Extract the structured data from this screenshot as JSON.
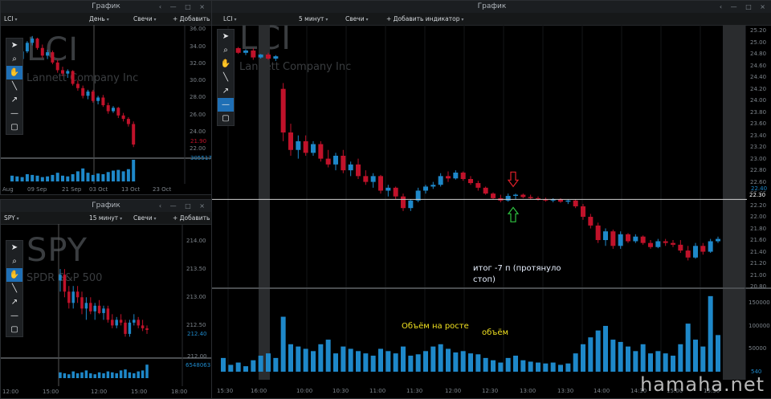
{
  "left_top": {
    "window_title": "График",
    "symbol": "LCI",
    "interval": "День",
    "style": "Свечи",
    "add": "+ Добавить",
    "watermark_symbol": "LCI",
    "watermark_name": "Lannett Company Inc",
    "price_labels": [
      "36.00",
      "34.00",
      "32.00",
      "30.00",
      "28.00",
      "26.00",
      "24.00",
      "22.00"
    ],
    "last_price": "21.90",
    "last_volume": "3055177",
    "x_labels": [
      "Aug",
      "09 Sep",
      "21 Sep",
      "03 Oct",
      "13 Oct",
      "23 Oct"
    ]
  },
  "left_bottom": {
    "window_title": "График",
    "symbol": "SPY",
    "interval": "15 минут",
    "style": "Свечи",
    "add": "+ Добавить",
    "watermark_symbol": "SPY",
    "watermark_name": "SPDR S&P 500",
    "price_labels": [
      "214.00",
      "213.50",
      "213.00",
      "212.50"
    ],
    "last_price": "212.40",
    "aux_label": "212.00",
    "last_volume": "6548063",
    "x_labels": [
      "12:00",
      "15:00",
      "12:00",
      "15:00",
      "18:00"
    ]
  },
  "main": {
    "window_title": "График",
    "symbol": "LCI",
    "interval": "5 минут",
    "style": "Свечи",
    "add_indicator": "+ Добавить индикатор",
    "watermark_symbol": "LCI",
    "watermark_name": "Lannett Company Inc",
    "price_labels": [
      "25.20",
      "25.00",
      "24.80",
      "24.60",
      "24.40",
      "24.20",
      "24.00",
      "23.80",
      "23.60",
      "23.40",
      "23.20",
      "23.00",
      "22.80",
      "22.60",
      "22.40",
      "22.20",
      "22.00",
      "21.80",
      "21.60",
      "21.40",
      "21.20",
      "21.00",
      "20.80"
    ],
    "hline_price": "22.30",
    "pre_price": "22.40",
    "volume_labels": [
      "150000",
      "100000",
      "50000"
    ],
    "last_volume": "540",
    "x_labels": [
      "15:30",
      "16:00",
      "10:00",
      "10:30",
      "11:00",
      "11:30",
      "12:00",
      "12:30",
      "13:00",
      "13:30",
      "14:00",
      "14:30",
      "15:00",
      "15:30"
    ],
    "annotation_result": "итог -7 п (протянуло\nстоп)",
    "annotation_volume_rise": "Объём на росте",
    "annotation_volume": "объём"
  },
  "tools": [
    "cursor-arrow",
    "zoom",
    "hand",
    "line",
    "arrow",
    "horizontal-line",
    "rectangle"
  ],
  "site_watermark": "hamaha.net",
  "colors": {
    "up": "#1e88c9",
    "down": "#c0122a",
    "volume": "#1e88c9",
    "hline": "#d0d0d0"
  },
  "chart_data": [
    {
      "type": "candlestick",
      "symbol": "LCI",
      "interval": "5 минут",
      "x": [
        "15:30",
        "16:00",
        "10:00",
        "10:30",
        "11:00",
        "11:30",
        "12:00",
        "12:30",
        "13:00",
        "13:30",
        "14:00",
        "14:30",
        "15:00",
        "15:30"
      ],
      "ylim": [
        20.8,
        25.3
      ],
      "candles_ohlc": [
        [
          24.88,
          24.95,
          24.78,
          24.85
        ],
        [
          24.85,
          24.92,
          24.8,
          24.9
        ],
        [
          24.9,
          24.92,
          24.8,
          24.82
        ],
        [
          24.82,
          24.88,
          24.78,
          24.86
        ],
        [
          24.86,
          24.9,
          24.7,
          24.74
        ],
        [
          24.74,
          24.8,
          24.72,
          24.79
        ],
        [
          24.79,
          24.82,
          24.7,
          24.72
        ],
        [
          24.72,
          24.78,
          24.68,
          24.76
        ],
        [
          24.2,
          24.3,
          23.3,
          23.45
        ],
        [
          23.45,
          23.6,
          23.05,
          23.15
        ],
        [
          23.15,
          23.4,
          23.0,
          23.3
        ],
        [
          23.3,
          23.4,
          23.05,
          23.1
        ],
        [
          23.1,
          23.3,
          23.05,
          23.25
        ],
        [
          23.25,
          23.3,
          22.95,
          23.0
        ],
        [
          23.0,
          23.15,
          22.85,
          22.9
        ],
        [
          22.9,
          23.1,
          22.8,
          23.05
        ],
        [
          23.05,
          23.15,
          22.75,
          22.8
        ],
        [
          22.8,
          22.95,
          22.7,
          22.9
        ],
        [
          22.9,
          23.0,
          22.65,
          22.7
        ],
        [
          22.7,
          22.8,
          22.55,
          22.6
        ],
        [
          22.6,
          22.75,
          22.5,
          22.7
        ],
        [
          22.7,
          22.72,
          22.4,
          22.45
        ],
        [
          22.45,
          22.55,
          22.35,
          22.5
        ],
        [
          22.5,
          22.52,
          22.3,
          22.35
        ],
        [
          22.35,
          22.4,
          22.1,
          22.15
        ],
        [
          22.15,
          22.3,
          22.1,
          22.28
        ],
        [
          22.28,
          22.5,
          22.25,
          22.45
        ],
        [
          22.45,
          22.55,
          22.4,
          22.52
        ],
        [
          22.52,
          22.6,
          22.48,
          22.55
        ],
        [
          22.55,
          22.75,
          22.52,
          22.7
        ],
        [
          22.7,
          22.78,
          22.6,
          22.66
        ],
        [
          22.66,
          22.8,
          22.64,
          22.76
        ],
        [
          22.76,
          22.78,
          22.62,
          22.65
        ],
        [
          22.65,
          22.7,
          22.55,
          22.58
        ],
        [
          22.58,
          22.62,
          22.45,
          22.5
        ],
        [
          22.5,
          22.52,
          22.38,
          22.4
        ],
        [
          22.4,
          22.42,
          22.3,
          22.32
        ],
        [
          22.32,
          22.38,
          22.25,
          22.28
        ],
        [
          22.28,
          22.4,
          22.26,
          22.36
        ],
        [
          22.36,
          22.4,
          22.3,
          22.38
        ],
        [
          22.38,
          22.4,
          22.32,
          22.34
        ],
        [
          22.34,
          22.38,
          22.3,
          22.32
        ],
        [
          22.32,
          22.35,
          22.28,
          22.3
        ],
        [
          22.3,
          22.33,
          22.26,
          22.28
        ],
        [
          22.28,
          22.32,
          22.25,
          22.3
        ],
        [
          22.3,
          22.32,
          22.24,
          22.26
        ],
        [
          22.26,
          22.3,
          22.22,
          22.28
        ],
        [
          22.28,
          22.3,
          22.15,
          22.18
        ],
        [
          22.18,
          22.22,
          21.95,
          22.0
        ],
        [
          22.0,
          22.05,
          21.8,
          21.85
        ],
        [
          21.85,
          21.9,
          21.55,
          21.6
        ],
        [
          21.6,
          21.8,
          21.5,
          21.75
        ],
        [
          21.75,
          21.78,
          21.45,
          21.5
        ],
        [
          21.5,
          21.75,
          21.45,
          21.7
        ],
        [
          21.7,
          21.72,
          21.55,
          21.58
        ],
        [
          21.58,
          21.7,
          21.55,
          21.66
        ],
        [
          21.66,
          21.68,
          21.52,
          21.55
        ],
        [
          21.55,
          21.6,
          21.45,
          21.48
        ],
        [
          21.48,
          21.62,
          21.46,
          21.58
        ],
        [
          21.58,
          21.62,
          21.5,
          21.55
        ],
        [
          21.55,
          21.6,
          21.48,
          21.52
        ],
        [
          21.52,
          21.6,
          21.38,
          21.42
        ],
        [
          21.42,
          21.5,
          21.25,
          21.3
        ],
        [
          21.3,
          21.55,
          21.28,
          21.5
        ],
        [
          21.5,
          21.55,
          21.35,
          21.4
        ],
        [
          21.4,
          21.62,
          21.38,
          21.58
        ],
        [
          21.58,
          21.66,
          21.55,
          21.62
        ]
      ],
      "volume": [
        30000,
        15000,
        20000,
        12000,
        25000,
        35000,
        40000,
        30000,
        120000,
        60000,
        55000,
        50000,
        45000,
        60000,
        70000,
        40000,
        55000,
        50000,
        45000,
        40000,
        35000,
        50000,
        45000,
        40000,
        55000,
        35000,
        38000,
        45000,
        55000,
        60000,
        50000,
        42000,
        45000,
        40000,
        38000,
        30000,
        25000,
        20000,
        30000,
        35000,
        25000,
        22000,
        20000,
        18000,
        20000,
        15000,
        18000,
        40000,
        60000,
        75000,
        90000,
        100000,
        70000,
        65000,
        55000,
        45000,
        60000,
        40000,
        45000,
        40000,
        35000,
        60000,
        105000,
        70000,
        55000,
        165000,
        80000
      ],
      "annotations": [
        "итог -7 п (протянуло\nстоп)",
        "Объём на росте",
        "объём"
      ]
    }
  ]
}
